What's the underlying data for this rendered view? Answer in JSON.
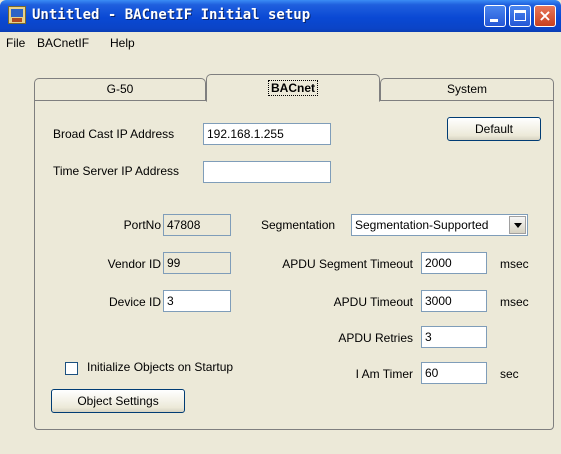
{
  "window": {
    "title": "Untitled - BACnetIF Initial setup",
    "app_icon": "computer-icon",
    "controls": {
      "minimize": "minimize-icon",
      "maximize": "maximize-icon",
      "close": "×"
    }
  },
  "menu": {
    "file": "File",
    "bacnetif": "BACnetIF",
    "help": "Help"
  },
  "tabs": {
    "g50": "G-50",
    "bacnet": "BACnet",
    "system": "System",
    "active": "BACnet"
  },
  "form": {
    "broadcast_ip_label": "Broad Cast IP Address",
    "broadcast_ip_value": "192.168.1.255",
    "time_server_label": "Time Server IP Address",
    "time_server_value": "",
    "default_button": "Default",
    "port_label": "PortNo",
    "port_value": "47808",
    "vendor_label": "Vendor ID",
    "vendor_value": "99",
    "device_label": "Device ID",
    "device_value": "3",
    "segmentation_label": "Segmentation",
    "segmentation_value": "Segmentation-Supported",
    "apdu_seg_timeout_label": "APDU Segment Timeout",
    "apdu_seg_timeout_value": "2000",
    "apdu_seg_timeout_unit": "msec",
    "apdu_timeout_label": "APDU Timeout",
    "apdu_timeout_value": "3000",
    "apdu_timeout_unit": "msec",
    "apdu_retries_label": "APDU Retries",
    "apdu_retries_value": "3",
    "iam_timer_label": "I Am Timer",
    "iam_timer_value": "60",
    "iam_timer_unit": "sec",
    "init_objects_label": "Initialize Objects on Startup",
    "init_objects_checked": false,
    "object_settings_button": "Object Settings"
  }
}
